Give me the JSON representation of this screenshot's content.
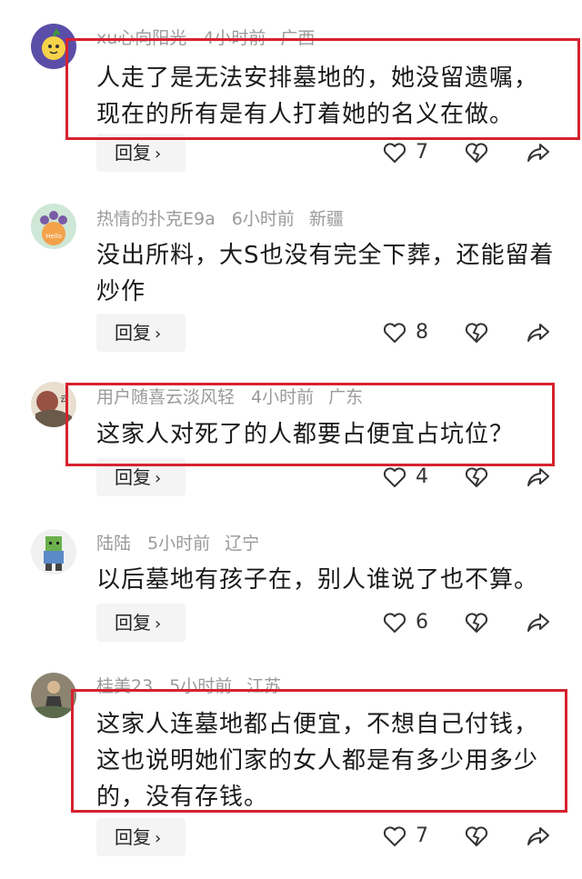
{
  "comments": [
    {
      "user": "xu心向阳光",
      "time": "4小时前",
      "location": "广西",
      "text": "人走了是无法安排墓地的，她没留遗嘱，现在的所有是有人打着她的名义在做。",
      "likes": "7",
      "highlighted": true
    },
    {
      "user": "热情的扑克E9a",
      "time": "6小时前",
      "location": "新疆",
      "text": "没出所料，大S也没有完全下葬，还能留着炒作",
      "likes": "8",
      "highlighted": false
    },
    {
      "user": "用户随喜云淡风轻",
      "time": "4小时前",
      "location": "广东",
      "text": "这家人对死了的人都要占便宜占坑位？",
      "likes": "4",
      "highlighted": true
    },
    {
      "user": "陆陆",
      "time": "5小时前",
      "location": "辽宁",
      "text": "以后墓地有孩子在，别人谁说了也不算。",
      "likes": "6",
      "highlighted": false
    },
    {
      "user": "桂美23",
      "time": "5小时前",
      "location": "江苏",
      "text": "这家人连墓地都占便宜，不想自己付钱，这也说明她们家的女人都是有多少用多少的，没有存钱。",
      "likes": "7",
      "highlighted": true
    }
  ],
  "reply_label": "回复",
  "reply_chevron": "›",
  "icons": {
    "like": "heart-outline-icon",
    "dislike": "broken-heart-icon",
    "share": "share-arrow-icon"
  },
  "colors": {
    "highlight_border": "#d6222f",
    "meta_text": "#9a9a9a",
    "body_text": "#1a1a1a",
    "reply_bg": "#f4f4f4"
  }
}
